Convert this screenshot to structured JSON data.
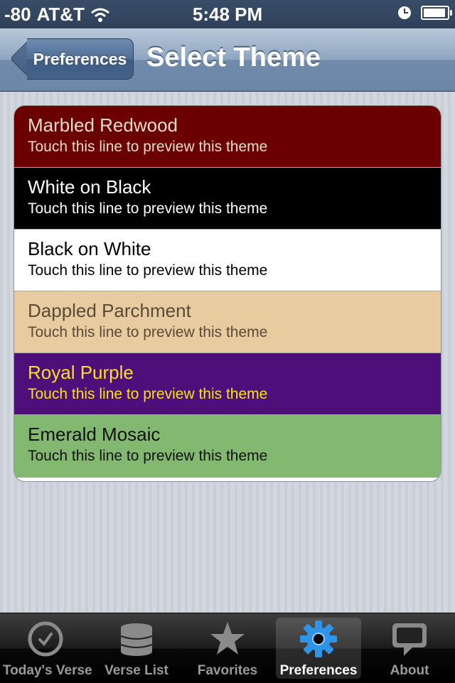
{
  "status_bar": {
    "signal": "-80",
    "carrier": "AT&T",
    "time": "5:48 PM",
    "battery_level": 0.95
  },
  "nav": {
    "back_label": "Preferences",
    "title": "Select Theme"
  },
  "themes": [
    {
      "name": "Marbled Redwood",
      "hint": "Touch this line to preview this theme",
      "bg": "#6b0000",
      "fg": "#e9dccf"
    },
    {
      "name": "White on Black",
      "hint": "Touch this line to preview this theme",
      "bg": "#000000",
      "fg": "#ffffff"
    },
    {
      "name": "Black on White",
      "hint": "Touch this line to preview this theme",
      "bg": "#ffffff",
      "fg": "#000000"
    },
    {
      "name": "Dappled Parchment",
      "hint": "Touch this line to preview this theme",
      "bg": "#e8cc9f",
      "fg": "#5a4a38"
    },
    {
      "name": "Royal Purple",
      "hint": "Touch this line to preview this theme",
      "bg": "#4e0f7a",
      "fg": "#f5e21a"
    },
    {
      "name": "Emerald Mosaic",
      "hint": "Touch this line to preview this theme",
      "bg": "#83b870",
      "fg": "#111111"
    }
  ],
  "tabs": [
    {
      "label": "Today's Verse",
      "icon": "clock-icon",
      "selected": false
    },
    {
      "label": "Verse List",
      "icon": "database-icon",
      "selected": false
    },
    {
      "label": "Favorites",
      "icon": "star-icon",
      "selected": false
    },
    {
      "label": "Preferences",
      "icon": "gear-icon",
      "selected": true
    },
    {
      "label": "About",
      "icon": "speech-bubble-icon",
      "selected": false
    }
  ]
}
